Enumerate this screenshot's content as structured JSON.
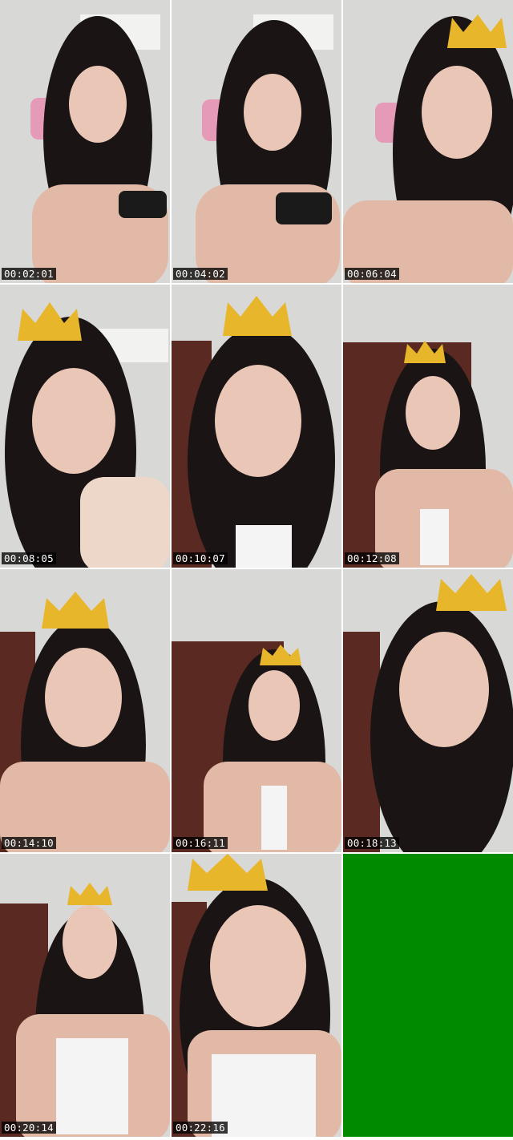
{
  "tiles": [
    {
      "timestamp": "00:02:01",
      "scene": "room-ac",
      "crown": false
    },
    {
      "timestamp": "00:04:02",
      "scene": "room-ac",
      "crown": false
    },
    {
      "timestamp": "00:06:04",
      "scene": "room-ac",
      "crown": true
    },
    {
      "timestamp": "00:08:05",
      "scene": "room-ac",
      "crown": true
    },
    {
      "timestamp": "00:10:07",
      "scene": "door",
      "crown": true
    },
    {
      "timestamp": "00:12:08",
      "scene": "door",
      "crown": true
    },
    {
      "timestamp": "00:14:10",
      "scene": "door",
      "crown": true
    },
    {
      "timestamp": "00:16:11",
      "scene": "door",
      "crown": true
    },
    {
      "timestamp": "00:18:13",
      "scene": "door",
      "crown": true
    },
    {
      "timestamp": "00:20:14",
      "scene": "door",
      "crown": true
    },
    {
      "timestamp": "00:22:16",
      "scene": "door",
      "crown": true
    }
  ],
  "filler_color": "#008a00",
  "colors": {
    "wall": "#dcdcda",
    "hair": "#1b1414",
    "skin": "#e9c6b6",
    "door": "#5a2a22",
    "crown": "#e7b62a"
  }
}
